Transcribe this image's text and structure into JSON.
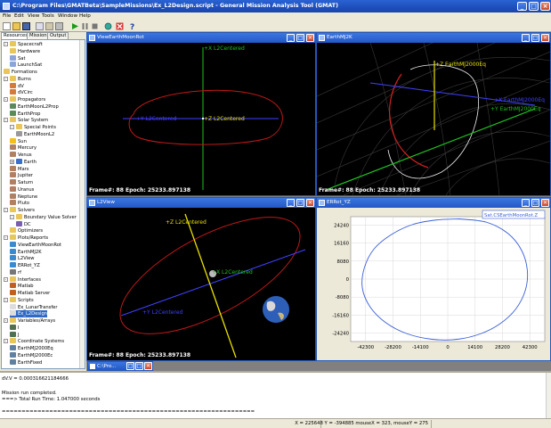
{
  "window": {
    "title": "C:\\Program Files\\GMATBeta\\SampleMissions\\Ex_L2Design.script - General Mission Analysis Tool (GMAT)"
  },
  "menu": [
    "File",
    "Edit",
    "View",
    "Tools",
    "Window",
    "Help"
  ],
  "toolbar_icons": [
    "new-icon",
    "open-icon",
    "save-icon",
    "copy-icon",
    "paste-icon",
    "print-icon",
    "run-icon",
    "pause-icon",
    "stop-icon",
    "animate-icon",
    "close-all-icon",
    "help-icon"
  ],
  "left_tabs": [
    "Resources",
    "Mission",
    "Output"
  ],
  "tree": [
    {
      "label": "Spacecraft",
      "level": 0,
      "icon": "folder-icon",
      "exp": "-"
    },
    {
      "label": "Hardware",
      "level": 1,
      "icon": "folder-icon"
    },
    {
      "label": "Sat",
      "level": 1,
      "icon": "spacecraft-icon"
    },
    {
      "label": "LaunchSat",
      "level": 1,
      "icon": "spacecraft-icon"
    },
    {
      "label": "Formations",
      "level": 0,
      "icon": "folder-icon"
    },
    {
      "label": "Burns",
      "level": 0,
      "icon": "folder-icon",
      "exp": "-"
    },
    {
      "label": "dV",
      "level": 1,
      "icon": "burn-icon"
    },
    {
      "label": "dVCirc",
      "level": 1,
      "icon": "burn-icon"
    },
    {
      "label": "Propagators",
      "level": 0,
      "icon": "folder-icon",
      "exp": "-"
    },
    {
      "label": "EarthMoonL2Prop",
      "level": 1,
      "icon": "propagator-icon"
    },
    {
      "label": "EarthProp",
      "level": 1,
      "icon": "propagator-icon"
    },
    {
      "label": "Solar System",
      "level": 0,
      "icon": "folder-icon",
      "exp": "-"
    },
    {
      "label": "Special Points",
      "level": 1,
      "icon": "folder-icon",
      "exp": "-"
    },
    {
      "label": "EarthMoonL2",
      "level": 2,
      "icon": "point-icon"
    },
    {
      "label": "Sun",
      "level": 1,
      "icon": "sun-icon"
    },
    {
      "label": "Mercury",
      "level": 1,
      "icon": "planet-icon"
    },
    {
      "label": "Venus",
      "level": 1,
      "icon": "planet-icon"
    },
    {
      "label": "Earth",
      "level": 1,
      "icon": "earth-icon",
      "exp": "+"
    },
    {
      "label": "Mars",
      "level": 1,
      "icon": "planet-icon"
    },
    {
      "label": "Jupiter",
      "level": 1,
      "icon": "planet-icon"
    },
    {
      "label": "Saturn",
      "level": 1,
      "icon": "planet-icon"
    },
    {
      "label": "Uranus",
      "level": 1,
      "icon": "planet-icon"
    },
    {
      "label": "Neptune",
      "level": 1,
      "icon": "planet-icon"
    },
    {
      "label": "Pluto",
      "level": 1,
      "icon": "planet-icon"
    },
    {
      "label": "Solvers",
      "level": 0,
      "icon": "folder-icon",
      "exp": "-"
    },
    {
      "label": "Boundary Value Solver",
      "level": 1,
      "icon": "folder-icon",
      "exp": "-"
    },
    {
      "label": "DC",
      "level": 2,
      "icon": "solver-icon"
    },
    {
      "label": "Optimizers",
      "level": 1,
      "icon": "folder-icon"
    },
    {
      "label": "Plots/Reports",
      "level": 0,
      "icon": "folder-icon",
      "exp": "-"
    },
    {
      "label": "ViewEarthMoonRot",
      "level": 1,
      "icon": "plot-icon"
    },
    {
      "label": "EarthMJ2K",
      "level": 1,
      "icon": "plot-icon"
    },
    {
      "label": "L2View",
      "level": 1,
      "icon": "plot-icon"
    },
    {
      "label": "ERRot_YZ",
      "level": 1,
      "icon": "plot-icon"
    },
    {
      "label": "rf",
      "level": 1,
      "icon": "report-icon"
    },
    {
      "label": "Interfaces",
      "level": 0,
      "icon": "folder-icon",
      "exp": "-"
    },
    {
      "label": "Matlab",
      "level": 1,
      "icon": "interface-icon"
    },
    {
      "label": "Matlab Server",
      "level": 1,
      "icon": "interface-icon"
    },
    {
      "label": "Scripts",
      "level": 0,
      "icon": "folder-icon",
      "exp": "-"
    },
    {
      "label": "Ex_LunarTransfer",
      "level": 1,
      "icon": "script-icon"
    },
    {
      "label": "Ex_L2Design",
      "level": 1,
      "icon": "script-icon",
      "selected": true
    },
    {
      "label": "Variables/Arrays",
      "level": 0,
      "icon": "folder-icon",
      "exp": "-"
    },
    {
      "label": "I",
      "level": 1,
      "icon": "variable-icon"
    },
    {
      "label": "J",
      "level": 1,
      "icon": "variable-icon"
    },
    {
      "label": "Coordinate Systems",
      "level": 0,
      "icon": "folder-icon",
      "exp": "-"
    },
    {
      "label": "EarthMJ2000Eq",
      "level": 1,
      "icon": "axes-icon"
    },
    {
      "label": "EarthMJ2000Ec",
      "level": 1,
      "icon": "axes-icon"
    },
    {
      "label": "EarthFixed",
      "level": 1,
      "icon": "axes-icon"
    }
  ],
  "windows": {
    "w1": {
      "title": "ViewEarthMoonRot",
      "frame_info": "Frame#: 88  Epoch: 25233.897138",
      "labels": {
        "x": "+X L2Centered",
        "z": "+Z L2Centered",
        "y": "+Y L2Centered"
      }
    },
    "w2": {
      "title": "EarthMJ2K",
      "frame_info": "Frame#: 88  Epoch: 25233.897138",
      "labels": {
        "x": "+X EarthMJ2000Eq",
        "z": "+Z EarthMJ2000Eq",
        "y": "+Y EarthMJ2000Eq"
      }
    },
    "w3": {
      "title": "L2View",
      "frame_info": "Frame#: 88  Epoch: 25233.897138",
      "labels": {
        "z": "+Z L2Centered",
        "x": "+X L2Centered",
        "y": "+Y L2Centered"
      }
    },
    "w4": {
      "title": "ERRot_YZ",
      "legend": "Sat.CSEarthMoonRot.Z"
    },
    "minimized": {
      "title": "C:\\Pro..."
    }
  },
  "chart_data": {
    "type": "line",
    "title": "",
    "xlabel": "",
    "ylabel": "",
    "xlim": [
      -50000,
      50000
    ],
    "ylim": [
      -28000,
      28000
    ],
    "x_ticks": [
      "-42300",
      "-28200",
      "-14100",
      "0",
      "14100",
      "28200",
      "42300"
    ],
    "y_ticks": [
      "24240",
      "16160",
      "8080",
      "0",
      "-8080",
      "-16160",
      "-24240"
    ],
    "grid": true,
    "legend_position": "top-right",
    "series": [
      {
        "name": "Sat.CSEarthMoonRot.Z",
        "color": "#3a5fd8",
        "x": [
          6000,
          20000,
          31000,
          38000,
          41000,
          40000,
          35000,
          27000,
          17000,
          5000,
          -8000,
          -21000,
          -32000,
          -40000,
          -44000,
          -43000,
          -38000,
          -29000,
          -18000,
          -6000,
          6000
        ],
        "y": [
          27000,
          25500,
          20500,
          13000,
          4000,
          -5000,
          -13500,
          -20000,
          -24500,
          -27000,
          -27000,
          -24500,
          -19500,
          -12500,
          -4000,
          5000,
          13500,
          20000,
          24500,
          26500,
          27000
        ]
      }
    ]
  },
  "messages": [
    "dV.V = 0.000316621184666",
    "",
    "Mission run completed.",
    "===> Total Run Time: 1.047000 seconds",
    "",
    "================================================================"
  ],
  "status": {
    "coords": "X = 225648 Y = -394885 mouseX = 323, mouseY = 275"
  },
  "colors": {
    "title_bar": "#1d4fba",
    "orbit_red": "#c01818",
    "axis_x": "#4040ff",
    "axis_y": "#20c020",
    "axis_z": "#e8e000"
  }
}
